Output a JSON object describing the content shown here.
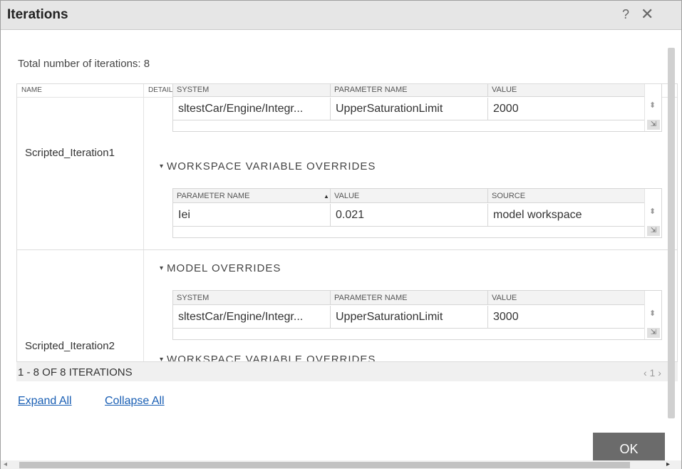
{
  "dialog": {
    "title": "Iterations",
    "help_glyph": "?",
    "close_glyph": "✕",
    "total_text": "Total number of iterations: 8"
  },
  "grid": {
    "headers": {
      "name": "NAME",
      "details": "DETAILS"
    },
    "iterations": [
      {
        "name": "Scripted_Iteration1",
        "model_overrides": {
          "headers": [
            "SYSTEM",
            "PARAMETER NAME",
            "VALUE"
          ],
          "row": [
            "sltestCar/Engine/Integr...",
            "UpperSaturationLimit",
            "2000"
          ]
        },
        "workspace_section_title": "WORKSPACE VARIABLE OVERRIDES",
        "workspace_overrides": {
          "headers": [
            "PARAMETER NAME",
            "VALUE",
            "SOURCE"
          ],
          "row": [
            "Iei",
            "0.021",
            "model workspace"
          ]
        }
      },
      {
        "name": "Scripted_Iteration2",
        "model_section_title": "MODEL OVERRIDES",
        "model_overrides": {
          "headers": [
            "SYSTEM",
            "PARAMETER NAME",
            "VALUE"
          ],
          "row": [
            "sltestCar/Engine/Integr...",
            "UpperSaturationLimit",
            "3000"
          ]
        },
        "workspace_section_title": "WORKSPACE VARIABLE OVERRIDES"
      }
    ],
    "footer_label": "1 - 8 OF 8 ITERATIONS",
    "pager": "‹ 1 ›"
  },
  "links": {
    "expand_all": "Expand All",
    "collapse_all": "Collapse All"
  },
  "buttons": {
    "ok": "OK"
  },
  "icons": {
    "caret_down": "▾",
    "sort_asc": "▲",
    "updown": "⬍",
    "resize": "⇲"
  },
  "colors": {
    "link": "#1a5fb4",
    "ok_button": "#6b6b6b",
    "titlebar": "#e6e6e6"
  }
}
